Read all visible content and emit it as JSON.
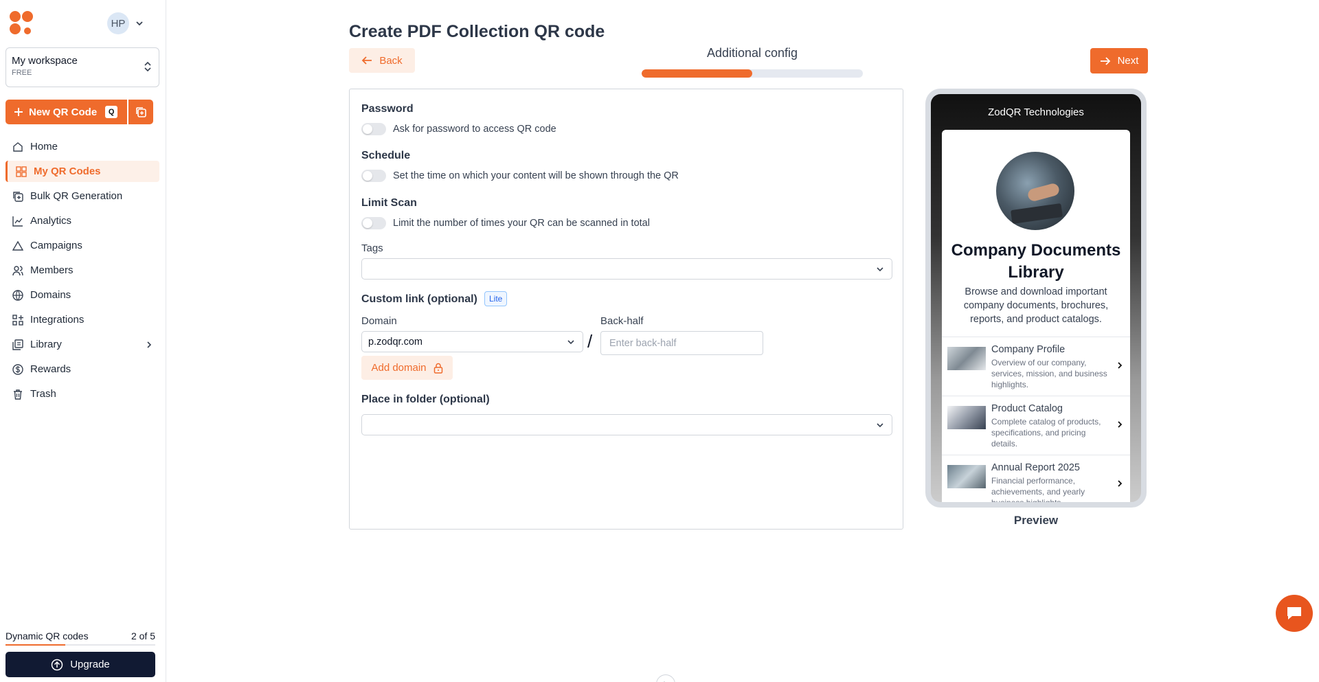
{
  "sidebar": {
    "avatar_initials": "HP",
    "workspace": {
      "name": "My workspace",
      "plan": "FREE"
    },
    "new_qr": {
      "label": "New QR Code",
      "shortcut": "Q"
    },
    "items": [
      {
        "label": "Home",
        "icon": "home-icon"
      },
      {
        "label": "My QR Codes",
        "icon": "grid-icon",
        "active": true
      },
      {
        "label": "Bulk QR Generation",
        "icon": "copy-plus-icon"
      },
      {
        "label": "Analytics",
        "icon": "chart-icon"
      },
      {
        "label": "Campaigns",
        "icon": "triangle-icon"
      },
      {
        "label": "Members",
        "icon": "users-icon"
      },
      {
        "label": "Domains",
        "icon": "globe-icon"
      },
      {
        "label": "Integrations",
        "icon": "puzzle-icon"
      },
      {
        "label": "Library",
        "icon": "library-icon"
      },
      {
        "label": "Rewards",
        "icon": "dollar-icon"
      },
      {
        "label": "Trash",
        "icon": "trash-icon"
      }
    ],
    "quota": {
      "label": "Dynamic QR codes",
      "value": "2 of 5",
      "fraction": 0.4
    },
    "upgrade_label": "Upgrade"
  },
  "header": {
    "title": "Create PDF Collection QR code",
    "back_label": "Back",
    "next_label": "Next",
    "step_label": "Additional config",
    "progress": 0.5
  },
  "config": {
    "password": {
      "title": "Password",
      "toggle_label": "Ask for password to access QR code"
    },
    "schedule": {
      "title": "Schedule",
      "toggle_label": "Set the time on which your content will be shown through the QR"
    },
    "limit_scan": {
      "title": "Limit Scan",
      "toggle_label": "Limit the number of times your QR can be scanned in total"
    },
    "tags_label": "Tags",
    "custom_link": {
      "title": "Custom link (optional)",
      "badge": "Lite",
      "domain_label": "Domain",
      "domain_value": "p.zodqr.com",
      "separator": "/",
      "backhalf_label": "Back-half",
      "backhalf_placeholder": "Enter back-half",
      "add_domain_label": "Add domain"
    },
    "folder_label": "Place in folder (optional)"
  },
  "preview": {
    "company": "ZodQR Technologies",
    "title": "Company Documents Library",
    "description": "Browse and download important company documents, brochures, reports, and product catalogs.",
    "documents": [
      {
        "title": "Company Profile",
        "desc": "Overview of our company, services, mission, and business highlights."
      },
      {
        "title": "Product Catalog",
        "desc": "Complete catalog of products, specifications, and pricing details."
      },
      {
        "title": "Annual Report 2025",
        "desc": "Financial performance, achievements, and yearly business highlights."
      }
    ],
    "label": "Preview"
  },
  "colors": {
    "accent": "#ef6b2c",
    "dark": "#111a33"
  }
}
